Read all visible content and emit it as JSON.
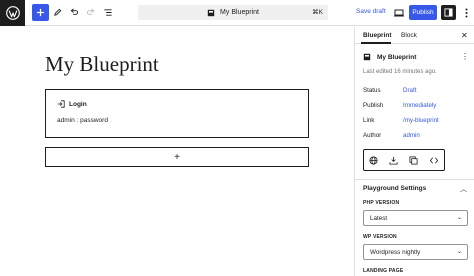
{
  "header": {
    "document_title": "My Blueprint",
    "shortcut": "⌘K",
    "save_draft": "Save draft",
    "publish": "Publish"
  },
  "canvas": {
    "post_title": "My Blueprint",
    "login_label": "Login",
    "credentials": "admin : password",
    "append_symbol": "+"
  },
  "sidebar": {
    "tabs": [
      "Blueprint",
      "Block"
    ],
    "doc_name": "My Blueprint",
    "last_edited": "Last edited 16 minutes ago.",
    "meta": [
      {
        "label": "Status",
        "value": "Draft"
      },
      {
        "label": "Publish",
        "value": "Immediately"
      },
      {
        "label": "Link",
        "value": "/my-blueprint"
      },
      {
        "label": "Author",
        "value": "admin"
      }
    ],
    "panel_title": "Playground Settings",
    "php_label": "PHP VERSION",
    "php_value": "Latest",
    "wp_label": "WP VERSION",
    "wp_value": "Wordpress nightly",
    "landing_label": "LANDING PAGE"
  },
  "colors": {
    "accent": "#3858e9",
    "dark": "#1e1e1e"
  }
}
